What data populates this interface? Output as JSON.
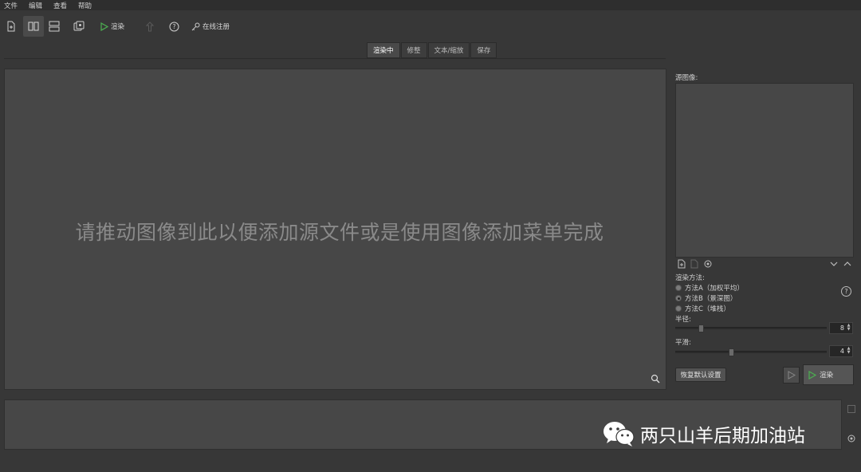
{
  "menu": [
    "文件",
    "编辑",
    "查看",
    "帮助"
  ],
  "toolbar": {
    "render_label": "渲染",
    "register_label": "在线注册"
  },
  "tabs": [
    {
      "label": "渲染中",
      "active": true
    },
    {
      "label": "修整",
      "active": false
    },
    {
      "label": "文本/缩放",
      "active": false
    },
    {
      "label": "保存",
      "active": false
    }
  ],
  "canvas": {
    "placeholder": "请推动图像到此以便添加源文件或是使用图像添加菜单完成"
  },
  "panel": {
    "source_label": "源图像:",
    "method_label": "渲染方法:",
    "methods": [
      "方法A（加权平均）",
      "方法B（景深图）",
      "方法C（堆栈）"
    ],
    "selected_method": 1,
    "radius_label": "半径:",
    "radius_value": "8",
    "radius_level": 0.15,
    "smooth_label": "平滑:",
    "smooth_value": "4",
    "smooth_level": 0.35,
    "reset_label": "恢复默认设置",
    "render_label": "渲染"
  },
  "watermark": {
    "text": "两只山羊后期加油站"
  },
  "colors": {
    "background": "#373737",
    "canvas": "#474747",
    "accent_green": "#4caf50"
  }
}
